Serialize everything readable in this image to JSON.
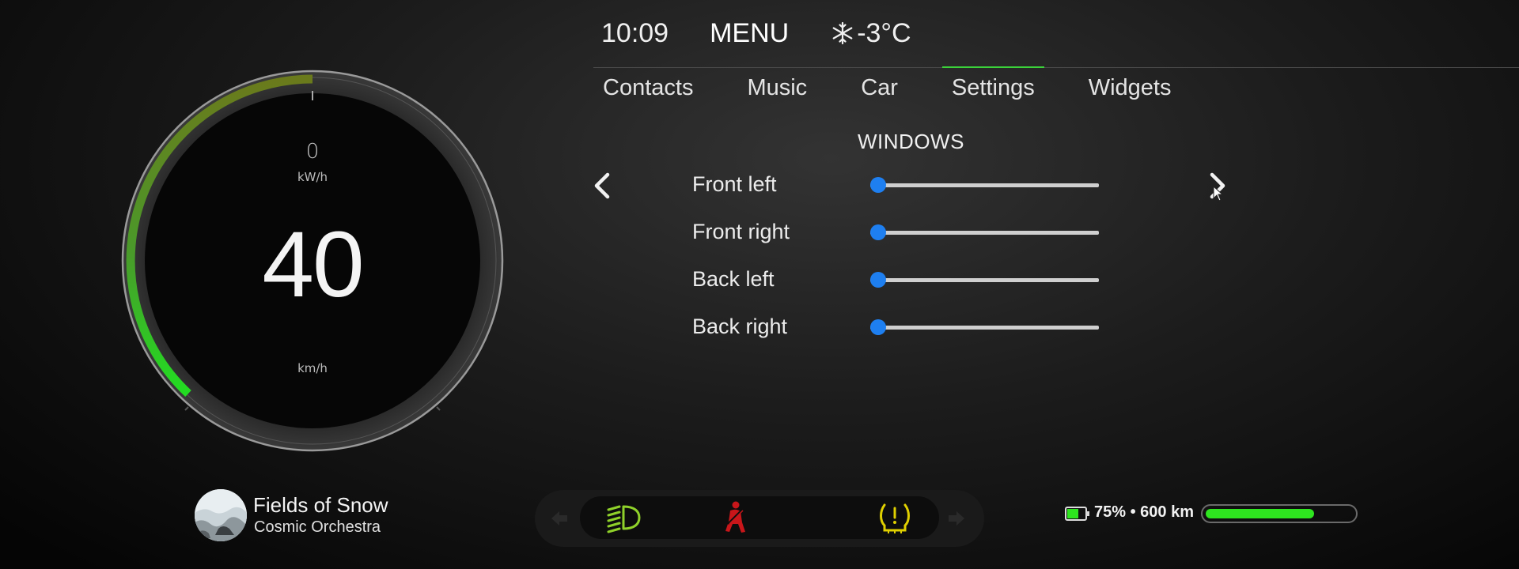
{
  "header": {
    "time": "10:09",
    "menu_label": "MENU",
    "temperature": "-3°C",
    "weather_icon": "snowflake-icon"
  },
  "tabs": [
    {
      "label": "Contacts",
      "active": false
    },
    {
      "label": "Music",
      "active": false
    },
    {
      "label": "Car",
      "active": false
    },
    {
      "label": "Settings",
      "active": true
    },
    {
      "label": "Widgets",
      "active": false
    }
  ],
  "gauge": {
    "power_value": "0",
    "power_unit": "kW/h",
    "speed_value": "40",
    "speed_unit": "km/h"
  },
  "windows": {
    "title": "WINDOWS",
    "rows": [
      {
        "label": "Front left",
        "value": 0
      },
      {
        "label": "Front right",
        "value": 0
      },
      {
        "label": "Back left",
        "value": 0
      },
      {
        "label": "Back right",
        "value": 0
      }
    ]
  },
  "media": {
    "title": "Fields of Snow",
    "artist": "Cosmic Orchestra"
  },
  "indicators": [
    {
      "name": "headlight-icon",
      "color": "#8fd12a"
    },
    {
      "name": "seatbelt-warning-icon",
      "color": "#c8161a"
    },
    {
      "name": "tire-pressure-icon",
      "color": "#e0d000"
    }
  ],
  "battery": {
    "text": "75% • 600 km",
    "percent": 75
  },
  "colors": {
    "accent_blue": "#1e7ff0",
    "accent_green": "#3bd23a"
  }
}
